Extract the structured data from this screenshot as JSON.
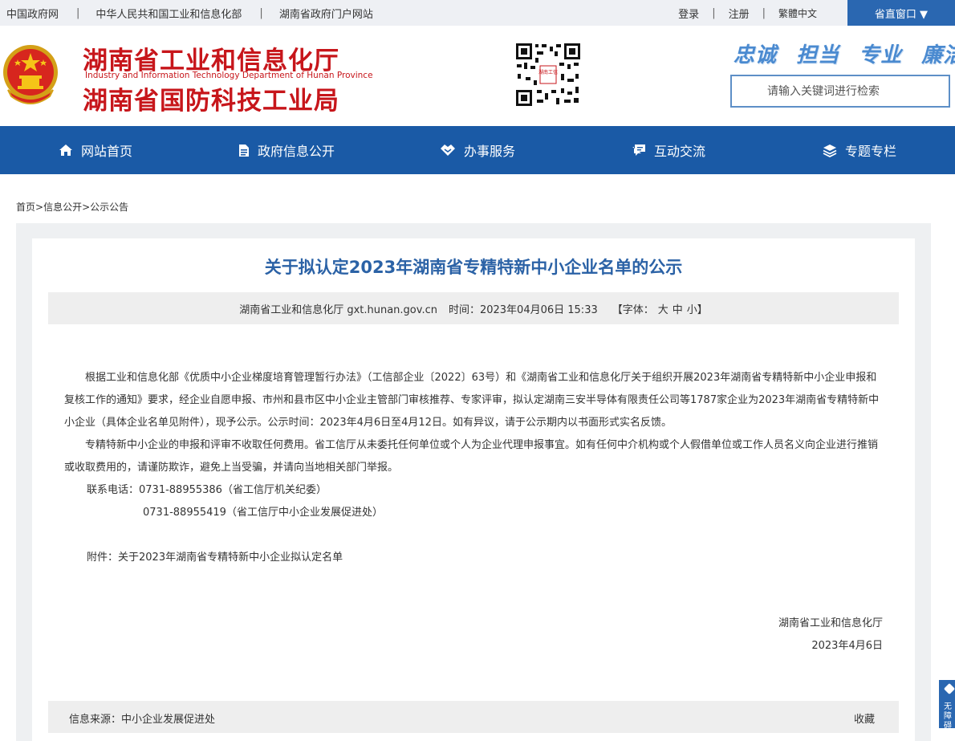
{
  "topbar": {
    "links": [
      "中国政府网",
      "中华人民共和国工业和信息化部",
      "湖南省政府门户网站"
    ],
    "separator": "|",
    "login": "登录",
    "register": "注册",
    "traditional": "繁體中文",
    "province_window": "省直窗口 ▼"
  },
  "header": {
    "title_cn_1": "湖南省工业和信息化厅",
    "title_en": "Industry and Information Technology Department of Hunan Province",
    "title_cn_2": "湖南省国防科技工业局",
    "qr_caption": "湖南工信",
    "slogans": [
      "忠诚",
      "担当",
      "专业",
      "廉洁"
    ],
    "search_placeholder": "请输入关键词进行检索"
  },
  "nav": [
    {
      "label": "网站首页",
      "icon": "home-icon"
    },
    {
      "label": "政府信息公开",
      "icon": "document-icon"
    },
    {
      "label": "办事服务",
      "icon": "handshake-icon"
    },
    {
      "label": "互动交流",
      "icon": "chat-icon"
    },
    {
      "label": "专题专栏",
      "icon": "layers-icon"
    }
  ],
  "breadcrumb": {
    "items": [
      "首页",
      "信息公开",
      "公示公告"
    ],
    "sep": ">"
  },
  "article": {
    "title": "关于拟认定2023年湖南省专精特新中小企业名单的公示",
    "meta_source": "湖南省工业和信息化厅 gxt.hunan.gov.cn",
    "meta_time": "时间：2023年04月06日 15:33",
    "font_label": "【字体：",
    "font_sizes": [
      "大",
      "中",
      "小"
    ],
    "font_close": "】",
    "para1": "根据工业和信息化部《优质中小企业梯度培育管理暂行办法》（工信部企业〔2022〕63号）和《湖南省工业和信息化厅关于组织开展2023年湖南省专精特新中小企业申报和复核工作的通知》要求，经企业自愿申报、市州和县市区中小企业主管部门审核推荐、专家评审，拟认定湖南三安半导体有限责任公司等1787家企业为2023年湖南省专精特新中小企业（具体企业名单见附件），现予公示。公示时间：2023年4月6日至4月12日。如有异议，请于公示期内以书面形式实名反馈。",
    "para2": "专精特新中小企业的申报和评审不收取任何费用。省工信厅从未委托任何单位或个人为企业代理申报事宜。如有任何中介机构或个人假借单位或工作人员名义向企业进行推销或收取费用的，请谨防欺诈，避免上当受骗，并请向当地相关部门举报。",
    "contact_1": "联系电话：0731-88955386（省工信厅机关纪委）",
    "contact_2": "0731-88955419（省工信厅中小企业发展促进处）",
    "attachment": "附件：关于2023年湖南省专精特新中小企业拟认定名单",
    "sign_org": "湖南省工业和信息化厅",
    "sign_date": "2023年4月6日",
    "source": "信息来源：中小企业发展促进处",
    "favorite": "收藏"
  },
  "float_tab": "无障碍",
  "colors": {
    "brand_red": "#c7161b",
    "nav_blue": "#1a5aa6",
    "title_blue": "#2b62a6"
  }
}
